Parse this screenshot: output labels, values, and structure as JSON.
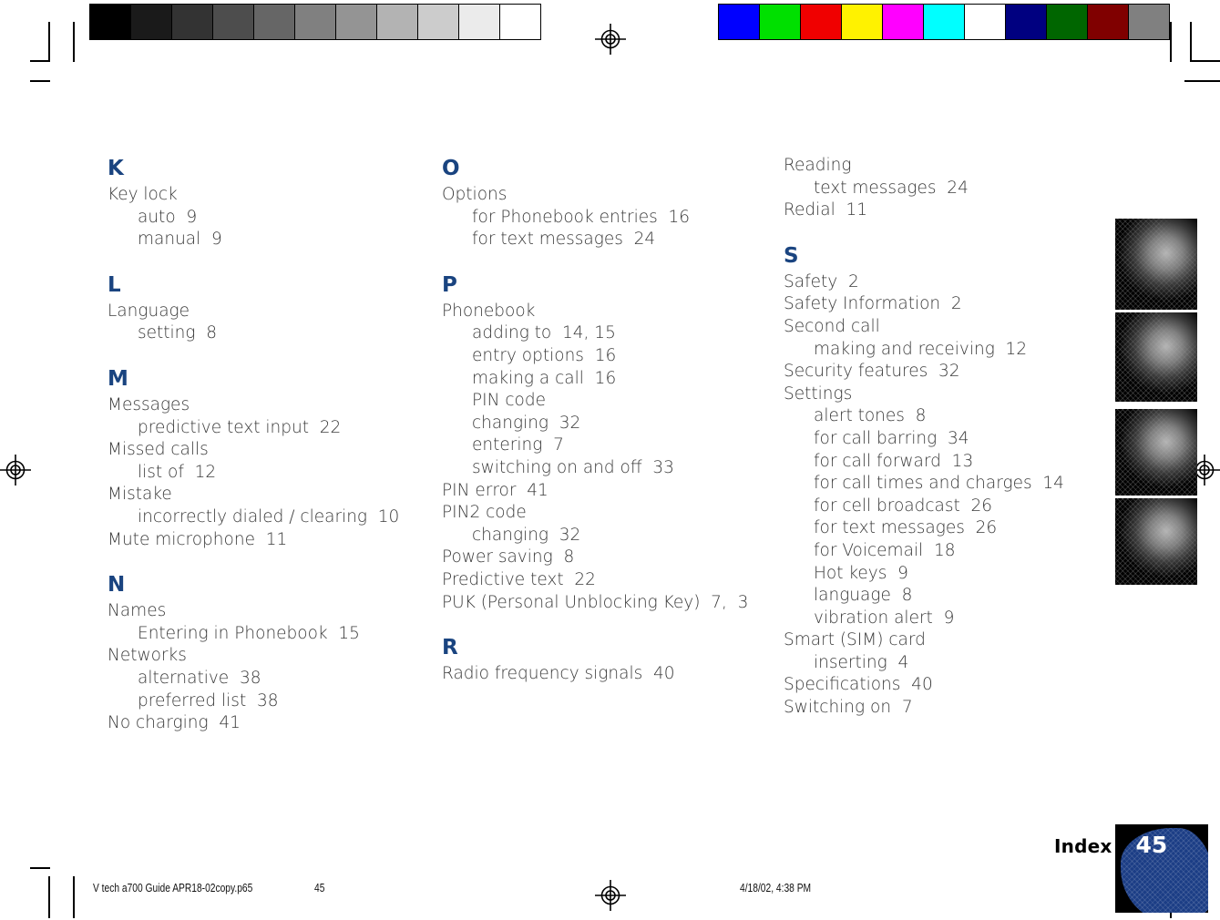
{
  "calibration": {
    "grayscale_label": "grayscale-step-wedge",
    "grayscale_swatches": [
      "#000000",
      "#1a1a1a",
      "#333333",
      "#4d4d4d",
      "#666666",
      "#808080",
      "#949494",
      "#b3b3b3",
      "#cccccc",
      "#ebebeb",
      "#ffffff"
    ],
    "color_label": "color-control-bar",
    "color_swatches": [
      "#0000ff",
      "#00e000",
      "#f00000",
      "#fff200",
      "#ff00ff",
      "#00ffff",
      "#ffffff",
      "#000080",
      "#006600",
      "#800000",
      "#808080"
    ]
  },
  "index": {
    "columns": [
      {
        "id": "column-1",
        "blocks": [
          {
            "letter": "K",
            "entries": [
              {
                "text": "Key lock",
                "sub": false
              },
              {
                "text": "auto  9",
                "sub": true
              },
              {
                "text": "manual  9",
                "sub": true
              }
            ]
          },
          {
            "letter": "L",
            "entries": [
              {
                "text": "Language",
                "sub": false
              },
              {
                "text": "setting  8",
                "sub": true
              }
            ]
          },
          {
            "letter": "M",
            "entries": [
              {
                "text": "Messages",
                "sub": false
              },
              {
                "text": "predictive text input  22",
                "sub": true
              },
              {
                "text": "Missed calls",
                "sub": false
              },
              {
                "text": "list of  12",
                "sub": true
              },
              {
                "text": "Mistake",
                "sub": false
              },
              {
                "text": "incorrectly dialed / clearing  10",
                "sub": true
              },
              {
                "text": "Mute microphone  11",
                "sub": false
              }
            ]
          },
          {
            "letter": "N",
            "entries": [
              {
                "text": "Names",
                "sub": false
              },
              {
                "text": "Entering in Phonebook  15",
                "sub": true
              },
              {
                "text": "Networks",
                "sub": false
              },
              {
                "text": "alternative  38",
                "sub": true
              },
              {
                "text": "preferred list  38",
                "sub": true
              },
              {
                "text": "No charging  41",
                "sub": false
              }
            ]
          }
        ]
      },
      {
        "id": "column-2",
        "blocks": [
          {
            "letter": "O",
            "entries": [
              {
                "text": "Options",
                "sub": false
              },
              {
                "text": "for Phonebook entries  16",
                "sub": true
              },
              {
                "text": "for text messages  24",
                "sub": true
              }
            ]
          },
          {
            "letter": "P",
            "entries": [
              {
                "text": "Phonebook",
                "sub": false
              },
              {
                "text": "adding to  14, 15",
                "sub": true
              },
              {
                "text": "entry options  16",
                "sub": true
              },
              {
                "text": "making a call  16",
                "sub": true
              },
              {
                "text": "PIN code",
                "sub": true
              },
              {
                "text": "changing  32",
                "sub": true
              },
              {
                "text": "entering  7",
                "sub": true
              },
              {
                "text": "switching on and off  33",
                "sub": true
              },
              {
                "text": "PIN error  41",
                "sub": false
              },
              {
                "text": "PIN2 code",
                "sub": false
              },
              {
                "text": "changing  32",
                "sub": true
              },
              {
                "text": "Power saving  8",
                "sub": false
              },
              {
                "text": "Predictive text  22",
                "sub": false
              },
              {
                "text": "PUK (Personal Unblocking Key)  7,  3",
                "sub": false
              }
            ]
          },
          {
            "letter": "R",
            "entries": [
              {
                "text": "Radio frequency signals  40",
                "sub": false
              }
            ]
          }
        ]
      },
      {
        "id": "column-3",
        "blocks": [
          {
            "letter": "",
            "entries": [
              {
                "text": "Reading",
                "sub": false
              },
              {
                "text": "text messages  24",
                "sub": true
              },
              {
                "text": "Redial  11",
                "sub": false
              }
            ]
          },
          {
            "letter": "S",
            "entries": [
              {
                "text": "Safety  2",
                "sub": false
              },
              {
                "text": "Safety Information  2",
                "sub": false
              },
              {
                "text": "Second call",
                "sub": false
              },
              {
                "text": "making and receiving  12",
                "sub": true
              },
              {
                "text": "Security features  32",
                "sub": false
              },
              {
                "text": "Settings",
                "sub": false
              },
              {
                "text": "alert tones  8",
                "sub": true
              },
              {
                "text": "for call barring  34",
                "sub": true
              },
              {
                "text": "for call forward  13",
                "sub": true
              },
              {
                "text": "for call times and charges  14",
                "sub": true
              },
              {
                "text": "for cell broadcast  26",
                "sub": true
              },
              {
                "text": "for text messages  26",
                "sub": true
              },
              {
                "text": "for Voicemail  18",
                "sub": true
              },
              {
                "text": "Hot keys  9",
                "sub": true
              },
              {
                "text": "language  8",
                "sub": true
              },
              {
                "text": "vibration alert  9",
                "sub": true
              },
              {
                "text": "Smart (SIM) card",
                "sub": false
              },
              {
                "text": "inserting  4",
                "sub": true
              },
              {
                "text": "Specifications  40",
                "sub": false
              },
              {
                "text": "Switching on  7",
                "sub": false
              }
            ]
          }
        ]
      }
    ]
  },
  "footer": {
    "section_label": "Index",
    "page_number": "45",
    "accent_color": "#1b3d85"
  },
  "printer_marks": {
    "file_name": "V tech a700 Guide APR18-02copy.p65",
    "page_number": "45",
    "timestamp": "4/18/02, 4:38 PM"
  }
}
